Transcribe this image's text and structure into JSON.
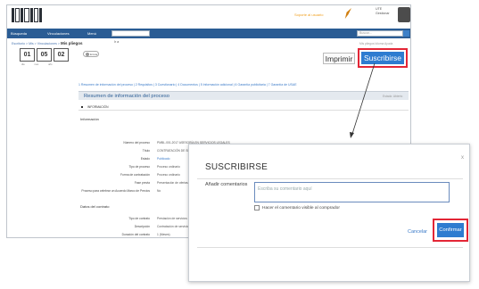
{
  "header": {
    "support_link": "Soporte al usuario",
    "user_name": "UTE",
    "user_role": "Gestionar"
  },
  "nav": {
    "items": [
      "Búsqueda",
      "Vinculaciones",
      "Menú"
    ],
    "select_value": "Ir a",
    "search_placeholder": "Buscar..."
  },
  "breadcrumb": {
    "path": "Escritorio > Mis > Vinculaciones >",
    "current": "Mis pliegos"
  },
  "top_right": "Mis pliegos  Idioma  Ayuda",
  "calendar": {
    "boxes": [
      "01",
      "05",
      "02"
    ],
    "labels": [
      "día",
      "mes",
      "año"
    ]
  },
  "share_label": "Enviar",
  "buttons": {
    "print": "Imprimir",
    "subscribe": "Suscribirse"
  },
  "section_links": "1 Resumen de información del proceso | 2 Requisitos | 3 Cuestionario | 4 Documentos | 5 Información adicional | 6 Garantía publicitaria | 7 Garantía de USAE",
  "section": {
    "title": "Resumen de información del proceso",
    "right": "Estado: Abierto"
  },
  "collapse_row": "INFORMACIÓN",
  "subsection_info": "Información",
  "fields": [
    {
      "label": "Número del proceso",
      "value": "PMBL-001-2017 ASESORÍA EN SERVICIOS LEGALES",
      "link": false
    },
    {
      "label": "Título",
      "value": "CONTRATACIÓN DE SERVICIOS PARA LA GESTIÓN",
      "link": false
    },
    {
      "label": "Estado",
      "value": "Publicado",
      "link": true
    },
    {
      "label": "Tipo de proceso",
      "value": "Proceso ordinario",
      "link": false
    },
    {
      "label": "Forma de contratación",
      "value": "Proceso ordinario",
      "link": false
    },
    {
      "label": "Fase previa",
      "value": "Presentación de ofertas",
      "link": false
    },
    {
      "label": "Proceso para celebrar un Acuerdo Marco de Precios",
      "value": "No",
      "link": false
    }
  ],
  "subsection_contract": "Datos del contrato",
  "contract_fields": [
    {
      "label": "Tipo de contrato",
      "value": "Prestación de servicios",
      "link": false
    },
    {
      "label": "Descripción",
      "value": "Contratación de servicios",
      "link": false
    },
    {
      "label": "Duración del contrato",
      "value": "1 (Meses)",
      "link": false
    }
  ],
  "modal": {
    "title": "SUSCRIBIRSE",
    "close": "x",
    "add_comment_label": "Añadir comentarios",
    "textarea_placeholder": "Escriba su comentario aquí",
    "checkbox_label": "Hacer el comentario visible al comprador",
    "cancel": "Cancelar",
    "confirm": "Confirmar"
  },
  "colors": {
    "accent": "#2e7cd0",
    "highlight": "#e32636",
    "nav": "#2a5c94"
  }
}
